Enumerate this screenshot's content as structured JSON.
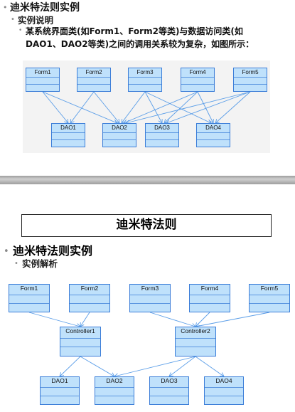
{
  "slide1": {
    "heading": "迪米特法则实例",
    "subheading": "实例说明",
    "body_line1": "某系统界面类(如Form1、Form2等类)与数据访问类(如",
    "body_line2": "DAO1、DAO2等类)之间的调用关系较为复杂，如图所示：",
    "forms": [
      "Form1",
      "Form2",
      "Form3",
      "Form4",
      "Form5"
    ],
    "daos": [
      "DAO1",
      "DAO2",
      "DAO3",
      "DAO4"
    ]
  },
  "slide2": {
    "title": "迪米特法则",
    "heading": "迪米特法则实例",
    "subheading": "实例解析",
    "forms": [
      "Form1",
      "Form2",
      "Form3",
      "Form4",
      "Form5"
    ],
    "controllers": [
      "Controller1",
      "Controller2"
    ],
    "daos": [
      "DAO1",
      "DAO2",
      "DAO3",
      "DAO4"
    ]
  },
  "colors": {
    "box_fill": "#bfe1fb",
    "box_border": "#3b7dd8",
    "arrow": "#5b9ee8"
  }
}
